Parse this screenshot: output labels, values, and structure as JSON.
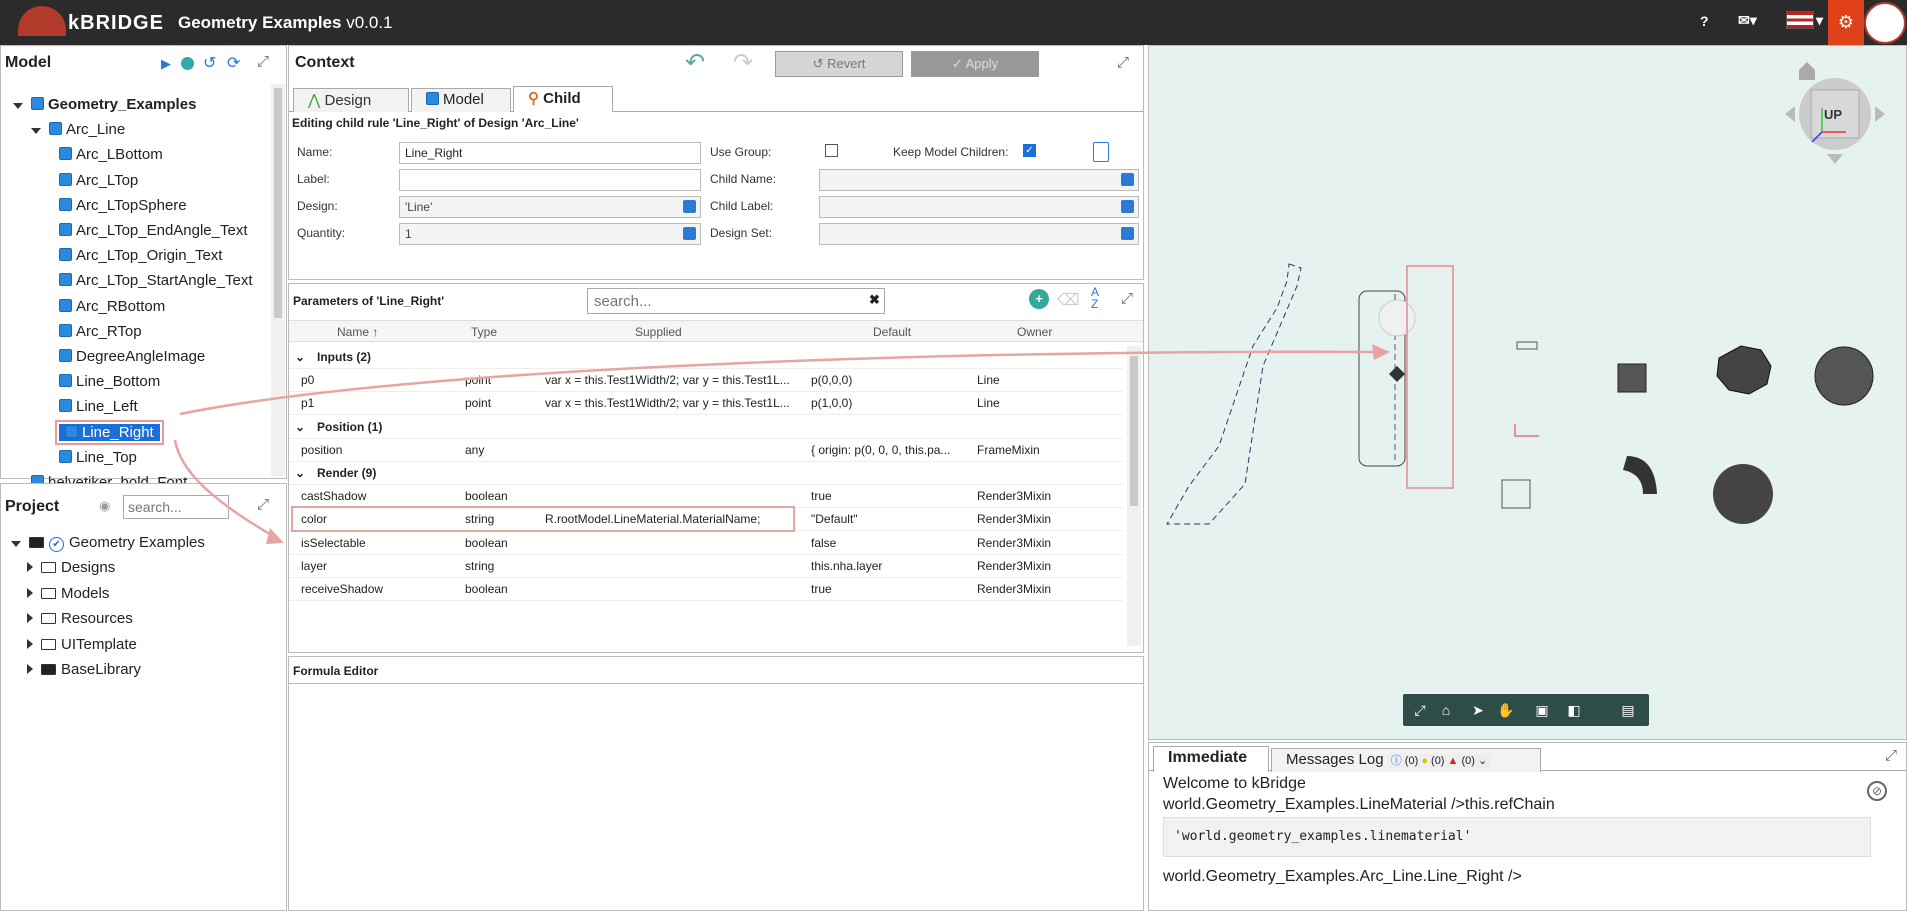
{
  "app": {
    "logo": "kBRIDGE",
    "title": "Geometry Examples",
    "version": "v0.0.1",
    "help": "?",
    "gear": "⚙"
  },
  "model_panel": {
    "title": "Model",
    "tree": [
      {
        "label": "Geometry_Examples",
        "level": 0,
        "expanded": true,
        "bold": true
      },
      {
        "label": "Arc_Line",
        "level": 1,
        "expanded": true
      },
      {
        "label": "Arc_LBottom",
        "level": 2
      },
      {
        "label": "Arc_LTop",
        "level": 2
      },
      {
        "label": "Arc_LTopSphere",
        "level": 2
      },
      {
        "label": "Arc_LTop_EndAngle_Text",
        "level": 2
      },
      {
        "label": "Arc_LTop_Origin_Text",
        "level": 2
      },
      {
        "label": "Arc_LTop_StartAngle_Text",
        "level": 2
      },
      {
        "label": "Arc_RBottom",
        "level": 2
      },
      {
        "label": "Arc_RTop",
        "level": 2
      },
      {
        "label": "DegreeAngleImage",
        "level": 2
      },
      {
        "label": "Line_Bottom",
        "level": 2
      },
      {
        "label": "Line_Left",
        "level": 2
      },
      {
        "label": "Line_Right",
        "level": 2,
        "selected": true
      },
      {
        "label": "Line_Top",
        "level": 2
      },
      {
        "label": "helvetiker_bold_Font",
        "level": 1
      }
    ]
  },
  "project_panel": {
    "title": "Project",
    "search_placeholder": "search...",
    "tree": [
      {
        "label": "Geometry Examples",
        "root": true
      },
      {
        "label": "Designs"
      },
      {
        "label": "Models"
      },
      {
        "label": "Resources"
      },
      {
        "label": "UITemplate"
      },
      {
        "label": "BaseLibrary",
        "filled": true
      }
    ]
  },
  "context": {
    "title": "Context",
    "revert": "Revert",
    "apply": "Apply",
    "tabs": [
      {
        "label": "Design"
      },
      {
        "label": "Model"
      },
      {
        "label": "Child",
        "active": true
      }
    ],
    "editing": "Editing child rule 'Line_Right' of Design 'Arc_Line'",
    "fields": {
      "name_label": "Name:",
      "name": "Line_Right",
      "label_label": "Label:",
      "label": "",
      "design_label": "Design:",
      "design": "'Line'",
      "quantity_label": "Quantity:",
      "quantity": "1",
      "use_group": "Use Group:",
      "keep_children": "Keep Model Children:",
      "child_name": "Child Name:",
      "child_label": "Child Label:",
      "design_set": "Design Set:"
    }
  },
  "params": {
    "title": "Parameters of 'Line_Right'",
    "search_placeholder": "search...",
    "columns": [
      "Name ↑",
      "Type",
      "Supplied",
      "Default",
      "Owner"
    ],
    "rows": [
      {
        "group": "Inputs (2)"
      },
      {
        "name": "p0",
        "type": "point",
        "supplied": "var x = this.Test1Width/2; var y = this.Test1L...",
        "default": "p(0,0,0)",
        "owner": "Line"
      },
      {
        "name": "p1",
        "type": "point",
        "supplied": "var x = this.Test1Width/2; var y = this.Test1L...",
        "default": "p(1,0,0)",
        "owner": "Line"
      },
      {
        "group": "Position (1)"
      },
      {
        "name": "position",
        "type": "any",
        "supplied": "",
        "default": "{ origin: p(0, 0, 0, this.pa...",
        "owner": "FrameMixin"
      },
      {
        "group": "Render (9)"
      },
      {
        "name": "castShadow",
        "type": "boolean",
        "supplied": "",
        "default": "true",
        "owner": "Render3Mixin"
      },
      {
        "name": "color",
        "type": "string",
        "supplied": "R.rootModel.LineMaterial.MaterialName;",
        "default": "\"Default\"",
        "owner": "Render3Mixin",
        "highlight": true
      },
      {
        "name": "isSelectable",
        "type": "boolean",
        "supplied": "",
        "default": "false",
        "owner": "Render3Mixin"
      },
      {
        "name": "layer",
        "type": "string",
        "supplied": "",
        "default": "this.nha.layer",
        "owner": "Render3Mixin"
      },
      {
        "name": "receiveShadow",
        "type": "boolean",
        "supplied": "",
        "default": "true",
        "owner": "Render3Mixin"
      }
    ]
  },
  "formula": {
    "title": "Formula Editor"
  },
  "viewer": {
    "cube_label": "UP",
    "axis_x": "x",
    "axis_y": "y",
    "axis_z": "z"
  },
  "console": {
    "tabs": [
      {
        "label": "Immediate",
        "active": true
      },
      {
        "label": "Messages Log"
      }
    ],
    "counts": [
      "(0)",
      "(0)",
      "(0)"
    ],
    "lines": [
      "Welcome to kBridge",
      "world.Geometry_Examples.LineMaterial />this.refChain"
    ],
    "result": "'world.geometry_examples.linematerial'",
    "prompt": "world.Geometry_Examples.Arc_Line.Line_Right />"
  },
  "colors": {
    "accent": "#1b6fd6",
    "topbar": "#2b2b2b",
    "gear_bg": "#e0401a",
    "viewer_bg": "#e6f2ef",
    "highlight": "#e8a3a3"
  }
}
